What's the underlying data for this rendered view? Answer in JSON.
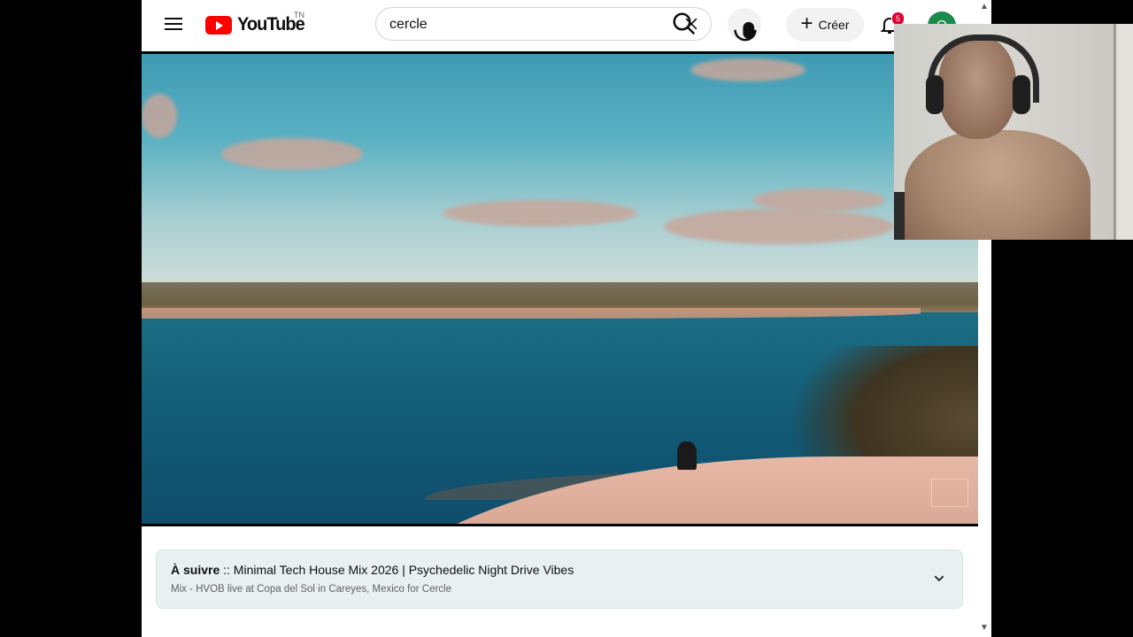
{
  "header": {
    "logo_text": "YouTube",
    "country_code": "TN",
    "search": {
      "query": "cercle"
    },
    "create_label": "Créer",
    "notification_count": "5",
    "avatar_initial": "O"
  },
  "up_next": {
    "prefix": "À suivre",
    "title": " :: Minimal Tech House Mix 2026 | Psychedelic Night Drive Vibes",
    "subtitle": "Mix - HVOB live at Copa del Sol in Careyes, Mexico for Cercle"
  },
  "icons": {
    "menu": "hamburger-menu-icon",
    "search": "search-icon",
    "clear": "close-icon",
    "mic": "microphone-icon",
    "create": "plus-icon",
    "bell": "bell-icon",
    "expand": "chevron-down-icon"
  },
  "colors": {
    "brand_red": "#ff0000",
    "notification_badge": "#e1002d",
    "up_next_bg": "#e8f1ef"
  }
}
